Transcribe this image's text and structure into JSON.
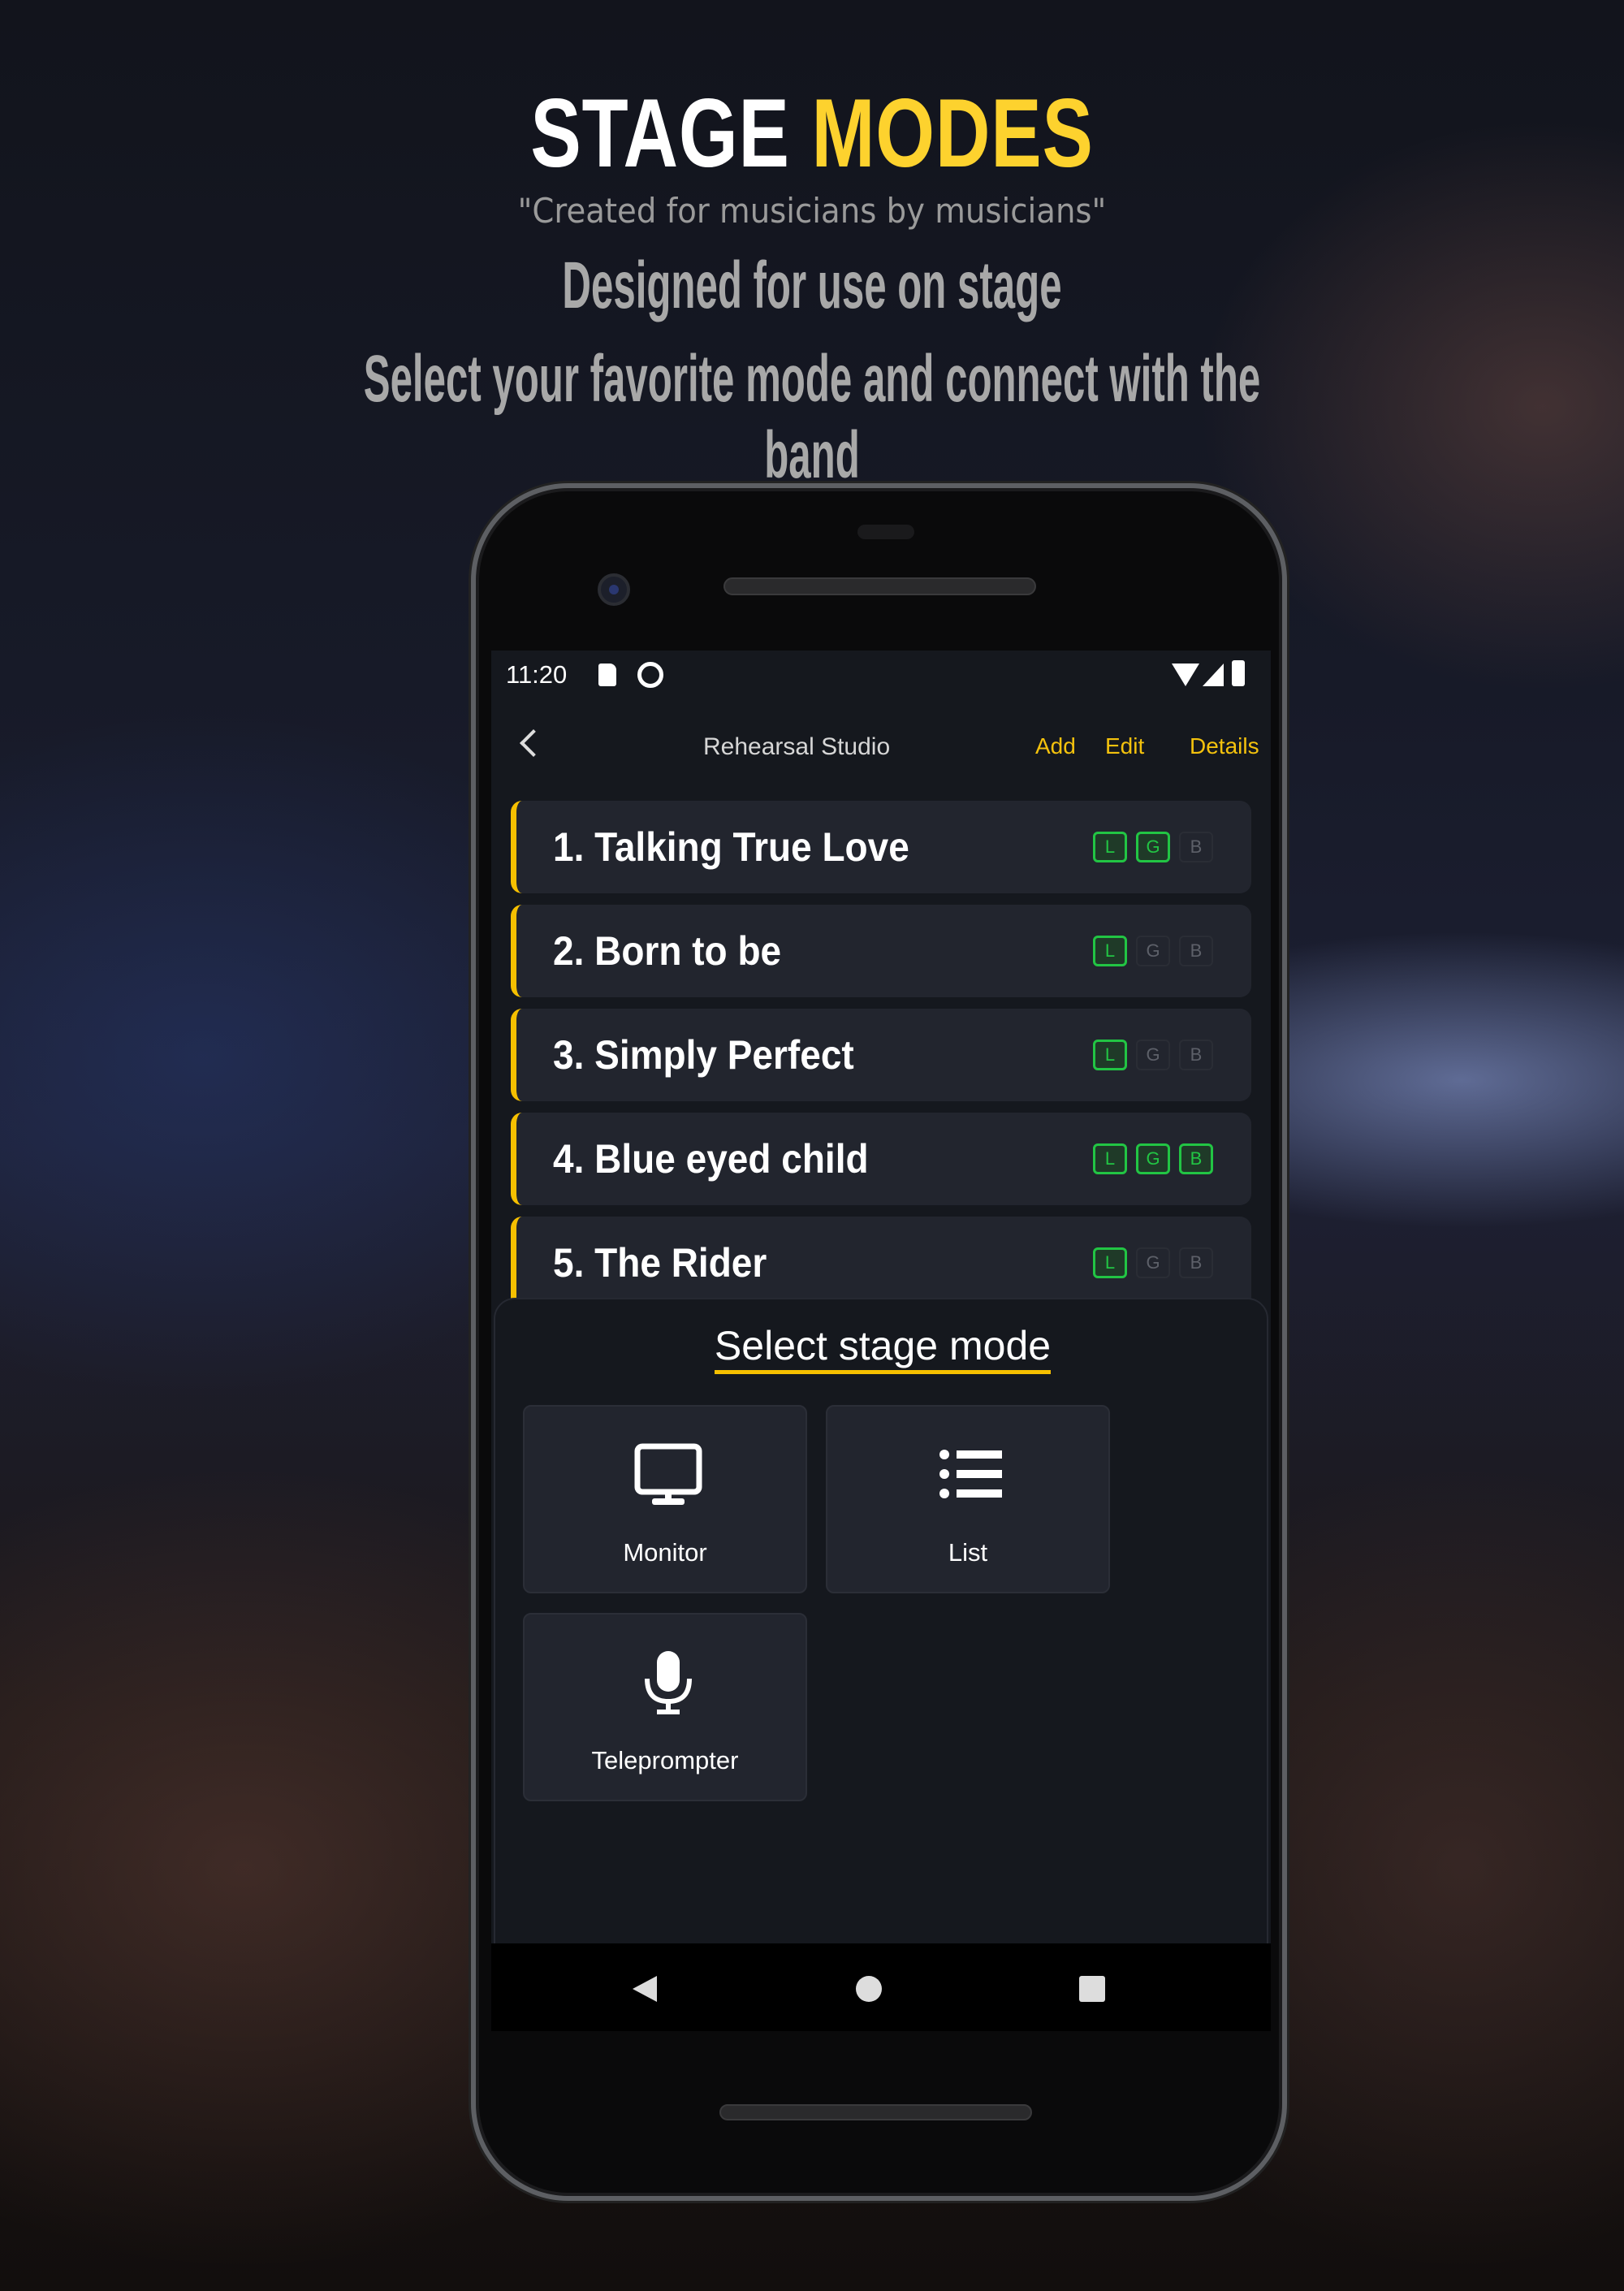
{
  "hero": {
    "title_part1": "STAGE",
    "title_part2": "MODES",
    "quote": "\"Created for musicians by musicians\"",
    "subtitle1": "Designed for use on stage",
    "subtitle2": "Select your favorite mode and connect with the band"
  },
  "status_bar": {
    "time": "11:20"
  },
  "header": {
    "title": "Rehearsal Studio",
    "add": "Add",
    "edit": "Edit",
    "details": "Details"
  },
  "songs": [
    {
      "title": "1. Talking True Love",
      "badges": [
        {
          "label": "L",
          "on": true
        },
        {
          "label": "G",
          "on": true
        },
        {
          "label": "B",
          "on": false
        }
      ]
    },
    {
      "title": "2. Born to be",
      "badges": [
        {
          "label": "L",
          "on": true
        },
        {
          "label": "G",
          "on": false
        },
        {
          "label": "B",
          "on": false
        }
      ]
    },
    {
      "title": "3. Simply Perfect",
      "badges": [
        {
          "label": "L",
          "on": true
        },
        {
          "label": "G",
          "on": false
        },
        {
          "label": "B",
          "on": false
        }
      ]
    },
    {
      "title": "4. Blue eyed child",
      "badges": [
        {
          "label": "L",
          "on": true
        },
        {
          "label": "G",
          "on": true
        },
        {
          "label": "B",
          "on": true
        }
      ]
    },
    {
      "title": "5. The Rider",
      "badges": [
        {
          "label": "L",
          "on": true
        },
        {
          "label": "G",
          "on": false
        },
        {
          "label": "B",
          "on": false
        }
      ]
    }
  ],
  "stage_mode": {
    "title": "Select stage mode",
    "modes": [
      {
        "label": "Monitor",
        "icon": "monitor-icon"
      },
      {
        "label": "List",
        "icon": "list-icon"
      },
      {
        "label": "Teleprompter",
        "icon": "microphone-icon"
      }
    ]
  },
  "colors": {
    "accent": "#f6c000",
    "badge_on": "#22c544",
    "title_accent": "#fdd22e"
  }
}
